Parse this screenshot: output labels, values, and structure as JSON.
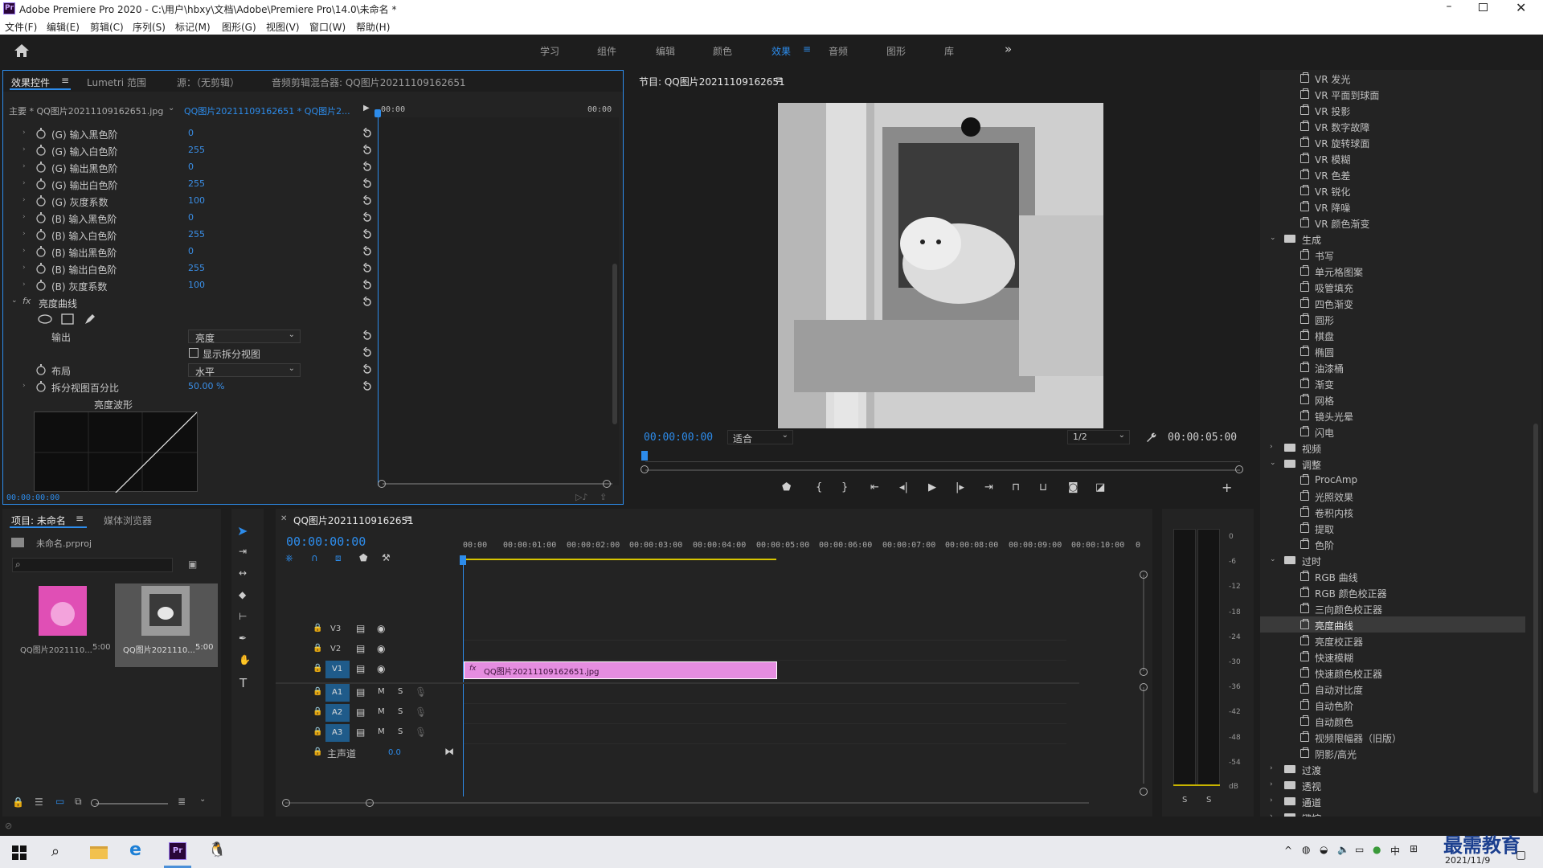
{
  "window": {
    "title": "Adobe Premiere Pro 2020 - C:\\用户\\hbxy\\文档\\Adobe\\Premiere Pro\\14.0\\未命名 *"
  },
  "menu": [
    "文件(F)",
    "编辑(E)",
    "剪辑(C)",
    "序列(S)",
    "标记(M)",
    "图形(G)",
    "视图(V)",
    "窗口(W)",
    "帮助(H)"
  ],
  "workspaces": {
    "items": [
      "学习",
      "组件",
      "编辑",
      "颜色",
      "效果",
      "音频",
      "图形",
      "库"
    ],
    "active": "效果",
    "more": "»"
  },
  "effect_controls": {
    "tabs": [
      "效果控件",
      "Lumetri 范围",
      "源：（无剪辑）",
      "音频剪辑混合器: QQ图片20211109162651"
    ],
    "master": "主要 * QQ图片20211109162651.jpg",
    "sequence": "QQ图片20211109162651 * QQ图片2...",
    "time_start": "00:00",
    "time_end": "00:00",
    "params": [
      {
        "name": "(G) 输入黑色阶",
        "value": "0"
      },
      {
        "name": "(G) 输入白色阶",
        "value": "255"
      },
      {
        "name": "(G) 输出黑色阶",
        "value": "0"
      },
      {
        "name": "(G) 输出白色阶",
        "value": "255"
      },
      {
        "name": "(G) 灰度系数",
        "value": "100"
      },
      {
        "name": "(B) 输入黑色阶",
        "value": "0"
      },
      {
        "name": "(B) 输入白色阶",
        "value": "255"
      },
      {
        "name": "(B) 输出黑色阶",
        "value": "0"
      },
      {
        "name": "(B) 输出白色阶",
        "value": "255"
      },
      {
        "name": "(B) 灰度系数",
        "value": "100"
      }
    ],
    "fx_name": "亮度曲线",
    "output_label": "输出",
    "output_value": "亮度",
    "split_view_label": "显示拆分视图",
    "layout_label": "布局",
    "layout_value": "水平",
    "split_pct_label": "拆分视图百分比",
    "split_pct_value": "50.00 %",
    "waveform_label": "亮度波形",
    "timecode": "00:00:00:00"
  },
  "program": {
    "title": "节目: QQ图片20211109162651",
    "timecode": "00:00:00:00",
    "fit": "适合",
    "quality": "1/2",
    "duration": "00:00:05:00"
  },
  "project": {
    "tabs": [
      "项目: 未命名",
      "媒体浏览器"
    ],
    "file": "未命名.prproj",
    "items": [
      {
        "name": "QQ图片2021110...",
        "duration": "5:00"
      },
      {
        "name": "QQ图片2021110...",
        "duration": "5:00"
      }
    ]
  },
  "timeline": {
    "title": "QQ图片20211109162651",
    "timecode": "00:00:00:00",
    "ruler": [
      "00:00",
      "00:00:01:00",
      "00:00:02:00",
      "00:00:03:00",
      "00:00:04:00",
      "00:00:05:00",
      "00:00:06:00",
      "00:00:07:00",
      "00:00:08:00",
      "00:00:09:00",
      "00:00:10:00",
      "0"
    ],
    "video_tracks": [
      "V3",
      "V2",
      "V1"
    ],
    "audio_tracks": [
      "A1",
      "A2",
      "A3"
    ],
    "master_label": "主声道",
    "master_value": "0.0",
    "clip_name": "QQ图片20211109162651.jpg",
    "clip_color": "#e58de0"
  },
  "meter": {
    "scale": [
      "0",
      "-6",
      "-12",
      "-18",
      "-24",
      "-30",
      "-36",
      "-42",
      "-48",
      "-54",
      "dB"
    ],
    "solo": [
      "S",
      "S"
    ]
  },
  "effects": {
    "vr_items": [
      "VR 发光",
      "VR 平面到球面",
      "VR 投影",
      "VR 数字故障",
      "VR 旋转球面",
      "VR 模糊",
      "VR 色差",
      "VR 锐化",
      "VR 降噪",
      "VR 颜色渐变"
    ],
    "folder_generate": "生成",
    "generate_items": [
      "书写",
      "单元格图案",
      "吸管填充",
      "四色渐变",
      "圆形",
      "棋盘",
      "椭圆",
      "油漆桶",
      "渐变",
      "网格",
      "镜头光晕",
      "闪电"
    ],
    "folder_video": "视频",
    "folder_adjust": "调整",
    "adjust_items": [
      "ProcAmp",
      "光照效果",
      "卷积内核",
      "提取",
      "色阶"
    ],
    "folder_obsolete": "过时",
    "obsolete_items": [
      "RGB 曲线",
      "RGB 颜色校正器",
      "三向颜色校正器",
      "亮度曲线",
      "亮度校正器",
      "快速模糊",
      "快速颜色校正器",
      "自动对比度",
      "自动色阶",
      "自动颜色",
      "视频限幅器（旧版）",
      "阴影/高光"
    ],
    "selected": "亮度曲线",
    "folder_transition": "过渡",
    "folder_perspective": "透视",
    "folder_channel": "通道",
    "folder_keying": "键控"
  },
  "taskbar": {
    "ime": "中",
    "date": "2021/11/9",
    "watermark": "最需教育"
  }
}
